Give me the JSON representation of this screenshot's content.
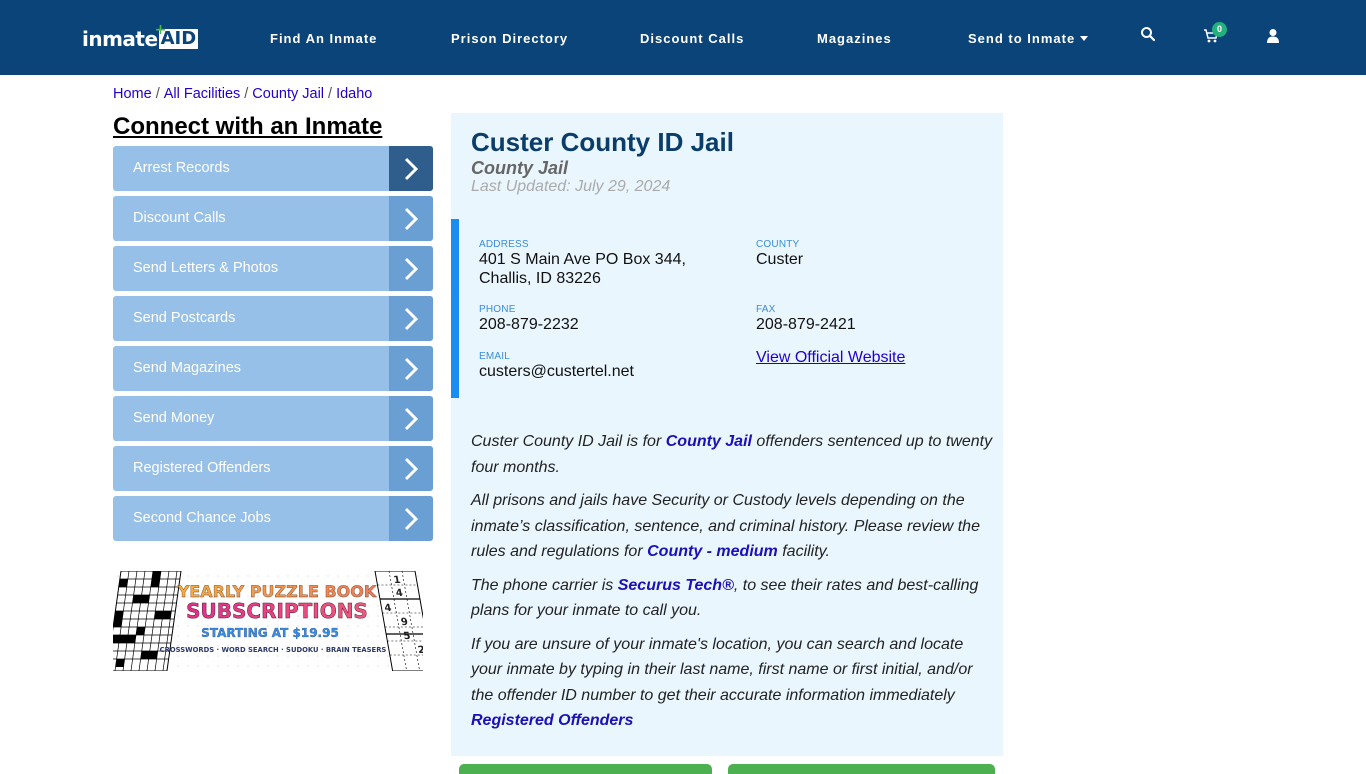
{
  "header": {
    "logo_text": "inmate",
    "logo_badge": "AID",
    "nav": [
      {
        "label": "Find An Inmate"
      },
      {
        "label": "Prison Directory"
      },
      {
        "label": "Discount Calls"
      },
      {
        "label": "Magazines"
      },
      {
        "label": "Send to Inmate",
        "has_dropdown": true
      }
    ],
    "cart_count": "0",
    "icons": [
      "search-icon",
      "cart-icon",
      "user-icon"
    ]
  },
  "breadcrumb": [
    {
      "label": "Home"
    },
    {
      "label": "All Facilities"
    },
    {
      "label": "County Jail"
    },
    {
      "label": "Idaho"
    }
  ],
  "sidebar": {
    "title": "Connect with an Inmate",
    "items": [
      {
        "label": "Arrest Records"
      },
      {
        "label": "Discount Calls"
      },
      {
        "label": "Send Letters & Photos"
      },
      {
        "label": "Send Postcards"
      },
      {
        "label": "Send Magazines"
      },
      {
        "label": "Send Money"
      },
      {
        "label": "Registered Offenders"
      },
      {
        "label": "Second Chance Jobs"
      }
    ],
    "ad": {
      "line1": "YEARLY PUZZLE BOOK",
      "line2": "SUBSCRIPTIONS",
      "line3": "STARTING AT $19.95",
      "line4": "CROSSWORDS · WORD SEARCH · SUDOKU · BRAIN TEASERS",
      "sudoku_digits": [
        "1",
        "4",
        "4",
        "9",
        "5",
        "2"
      ]
    }
  },
  "facility": {
    "name": "Custer County ID Jail",
    "type": "County Jail",
    "last_updated": "Last Updated: July 29, 2024",
    "address_label": "ADDRESS",
    "address_line1": "401 S Main Ave PO Box 344,",
    "address_line2": "Challis, ID 83226",
    "county_label": "COUNTY",
    "county": "Custer",
    "phone_label": "PHONE",
    "phone": "208-879-2232",
    "fax_label": "FAX",
    "fax": "208-879-2421",
    "email_label": "EMAIL",
    "email": "custers@custertel.net",
    "website_link": "View Official Website"
  },
  "description": {
    "p1_a": "Custer County ID Jail is for ",
    "p1_link": "County Jail",
    "p1_b": " offenders sentenced up to twenty four months.",
    "p2_a": "All prisons and jails have Security or Custody levels depending on the inmate’s classification, sentence, and criminal history. Please review the rules and regulations for ",
    "p2_link": "County - medium",
    "p2_b": " facility.",
    "p3_a": "The phone carrier is ",
    "p3_link": "Securus Tech®",
    "p3_b": ", to see their rates and best-calling plans for your inmate to call you.",
    "p4": "If you are unsure of your inmate's location, you can search and locate your inmate by typing in their last name, first name or first initial, and/or the offender ID number to get their accurate information immediately",
    "p4_link": "Registered Offenders"
  },
  "colors": {
    "header_bg": "#0b4479",
    "sidebar_item": "#97c0e8",
    "sidebar_arrow": "#6a9fd4",
    "sidebar_arrow_active": "#2f5d8c",
    "panel_bg": "#eaf6fe",
    "accent_bar": "#1a8ef0",
    "link": "#2200cc",
    "button_green": "#4caf50"
  }
}
